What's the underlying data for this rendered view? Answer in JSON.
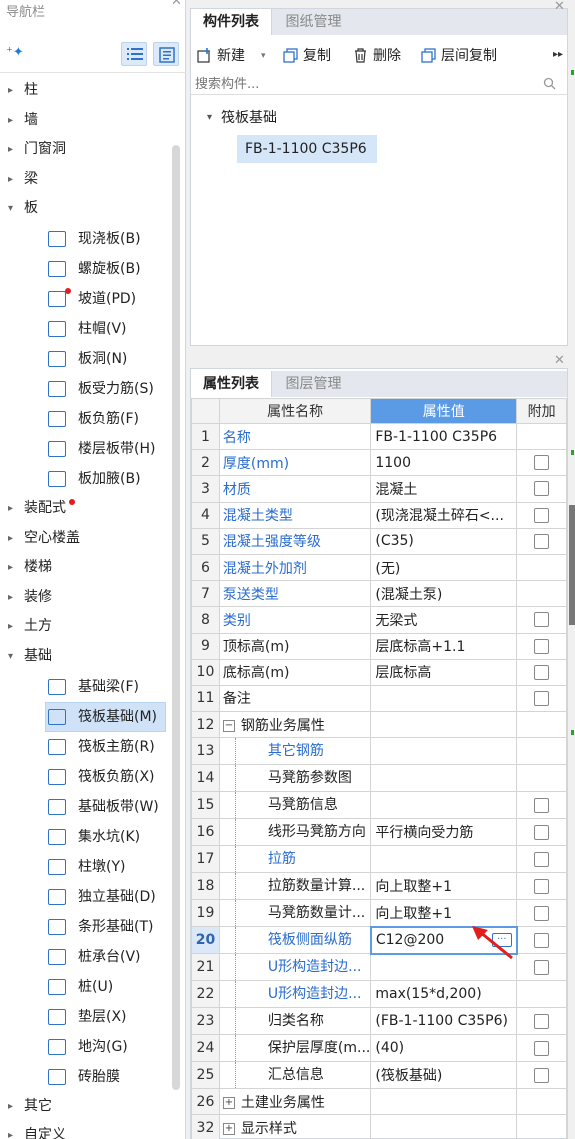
{
  "nav": {
    "title": "导航栏",
    "categories_top": [
      "柱",
      "墙",
      "门窗洞",
      "梁"
    ],
    "ban": {
      "label": "板",
      "items": [
        "现浇板(B)",
        "螺旋板(B)",
        "坡道(PD)",
        "柱帽(V)",
        "板洞(N)",
        "板受力筋(S)",
        "板负筋(F)",
        "楼层板带(H)",
        "板加腋(B)"
      ],
      "icons": [
        "slab-icon",
        "spiral-slab-icon",
        "ramp-icon",
        "column-cap-icon",
        "slab-hole-icon",
        "slab-main-rebar-icon",
        "slab-neg-rebar-icon",
        "floor-strip-icon",
        "slab-haunch-icon"
      ]
    },
    "categories_mid": [
      "装配式",
      "空心楼盖",
      "楼梯",
      "装修",
      "土方"
    ],
    "jichu": {
      "label": "基础",
      "items": [
        "基础梁(F)",
        "筏板基础(M)",
        "筏板主筋(R)",
        "筏板负筋(X)",
        "基础板带(W)",
        "集水坑(K)",
        "柱墩(Y)",
        "独立基础(D)",
        "条形基础(T)",
        "桩承台(V)",
        "桩(U)",
        "垫层(X)",
        "地沟(G)",
        "砖胎膜"
      ],
      "selected": 1,
      "icons": [
        "foundation-beam-icon",
        "raft-foundation-icon",
        "raft-main-rebar-icon",
        "raft-neg-rebar-icon",
        "foundation-strip-icon",
        "sump-pit-icon",
        "column-pier-icon",
        "isolated-footing-icon",
        "strip-footing-icon",
        "pile-cap-icon",
        "pile-icon",
        "cushion-icon",
        "trench-icon",
        "brick-mold-icon"
      ]
    },
    "categories_bottom": [
      "其它",
      "自定义"
    ]
  },
  "component_panel": {
    "tabs": [
      "构件列表",
      "图纸管理"
    ],
    "toolbar": {
      "new": "新建",
      "copy": "复制",
      "delete": "删除",
      "floor_copy": "层间复制"
    },
    "search_placeholder": "搜索构件...",
    "tree_root": "筏板基础",
    "tree_item": "FB-1-1100 C35P6"
  },
  "property_panel": {
    "tabs": [
      "属性列表",
      "图层管理"
    ],
    "headers": {
      "name": "属性名称",
      "value": "属性值",
      "extra": "附加"
    },
    "rows": [
      {
        "n": "1",
        "name": "名称",
        "value": "FB-1-1100 C35P6",
        "blue": true,
        "chk": false,
        "ind": false
      },
      {
        "n": "2",
        "name": "厚度(mm)",
        "value": "1100",
        "blue": true,
        "chk": true,
        "ind": false
      },
      {
        "n": "3",
        "name": "材质",
        "value": "混凝土",
        "blue": true,
        "chk": true,
        "ind": false
      },
      {
        "n": "4",
        "name": "混凝土类型",
        "value": "(现浇混凝土碎石<...",
        "blue": true,
        "chk": true,
        "ind": false
      },
      {
        "n": "5",
        "name": "混凝土强度等级",
        "value": "(C35)",
        "blue": true,
        "chk": true,
        "ind": false
      },
      {
        "n": "6",
        "name": "混凝土外加剂",
        "value": "(无)",
        "blue": true,
        "chk": false,
        "ind": false
      },
      {
        "n": "7",
        "name": "泵送类型",
        "value": "(混凝土泵)",
        "blue": true,
        "chk": false,
        "ind": false
      },
      {
        "n": "8",
        "name": "类别",
        "value": "无梁式",
        "blue": true,
        "chk": true,
        "ind": false
      },
      {
        "n": "9",
        "name": "顶标高(m)",
        "value": "层底标高+1.1",
        "blue": false,
        "chk": true,
        "ind": false
      },
      {
        "n": "10",
        "name": "底标高(m)",
        "value": "层底标高",
        "blue": false,
        "chk": true,
        "ind": false
      },
      {
        "n": "11",
        "name": "备注",
        "value": "",
        "blue": false,
        "chk": true,
        "ind": false
      },
      {
        "n": "12",
        "name": "钢筋业务属性",
        "value": "",
        "blue": false,
        "chk": false,
        "ind": false,
        "group": "−"
      },
      {
        "n": "13",
        "name": "其它钢筋",
        "value": "",
        "blue": true,
        "chk": false,
        "ind": true
      },
      {
        "n": "14",
        "name": "马凳筋参数图",
        "value": "",
        "blue": false,
        "chk": false,
        "ind": true
      },
      {
        "n": "15",
        "name": "马凳筋信息",
        "value": "",
        "blue": false,
        "chk": true,
        "ind": true
      },
      {
        "n": "16",
        "name": "线形马凳筋方向",
        "value": "平行横向受力筋",
        "blue": false,
        "chk": true,
        "ind": true
      },
      {
        "n": "17",
        "name": "拉筋",
        "value": "",
        "blue": true,
        "chk": true,
        "ind": true
      },
      {
        "n": "18",
        "name": "拉筋数量计算...",
        "value": "向上取整+1",
        "blue": false,
        "chk": true,
        "ind": true
      },
      {
        "n": "19",
        "name": "马凳筋数量计...",
        "value": "向上取整+1",
        "blue": false,
        "chk": true,
        "ind": true
      },
      {
        "n": "20",
        "name": "筏板侧面纵筋",
        "value": "C12@200",
        "blue": true,
        "chk": true,
        "ind": true,
        "sel": true
      },
      {
        "n": "21",
        "name": "U形构造封边...",
        "value": "",
        "blue": true,
        "chk": true,
        "ind": true
      },
      {
        "n": "22",
        "name": "U形构造封边...",
        "value": "max(15*d,200)",
        "blue": true,
        "chk": false,
        "ind": true
      },
      {
        "n": "23",
        "name": "归类名称",
        "value": "(FB-1-1100 C35P6)",
        "blue": false,
        "chk": true,
        "ind": true
      },
      {
        "n": "24",
        "name": "保护层厚度(m...",
        "value": "(40)",
        "blue": false,
        "chk": true,
        "ind": true
      },
      {
        "n": "25",
        "name": "汇总信息",
        "value": "(筏板基础)",
        "blue": false,
        "chk": true,
        "ind": true
      },
      {
        "n": "26",
        "name": "土建业务属性",
        "value": "",
        "blue": false,
        "chk": false,
        "ind": false,
        "group": "+"
      },
      {
        "n": "32",
        "name": "显示样式",
        "value": "",
        "blue": false,
        "chk": false,
        "ind": false,
        "group": "+"
      }
    ],
    "more_button": "···"
  },
  "colors": {
    "accent": "#5b9be6",
    "label_blue": "#2a6ccf",
    "selection": "#d5e6f8",
    "red_marker": "#e21d1d"
  }
}
